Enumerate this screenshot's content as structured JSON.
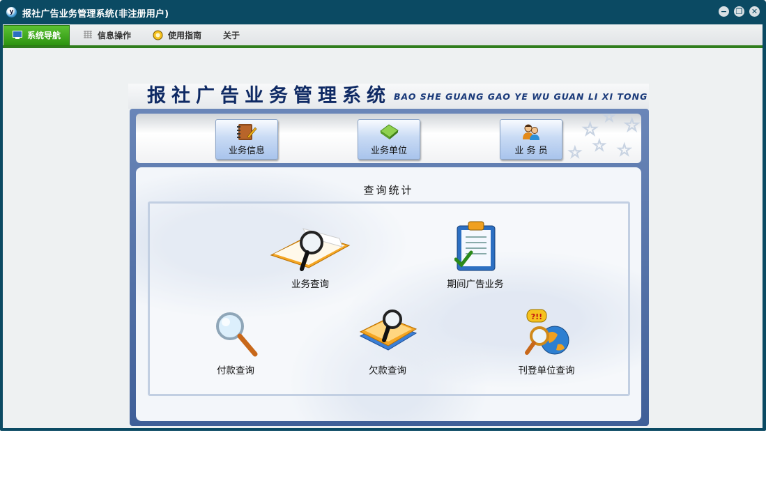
{
  "window": {
    "title": "报社广告业务管理系统(非注册用户)",
    "controls": [
      "minimize",
      "restore",
      "close"
    ]
  },
  "menu": {
    "items": [
      {
        "label": "系统导航",
        "icon": "monitor-icon",
        "active": true
      },
      {
        "label": "信息操作",
        "icon": "grid-icon",
        "active": false
      },
      {
        "label": "使用指南",
        "icon": "guide-icon",
        "active": false
      },
      {
        "label": "关于",
        "icon": "",
        "active": false
      }
    ]
  },
  "banner": {
    "title_cn": "报社广告业务管理系统",
    "title_en": "BAO SHE GUANG GAO YE WU GUAN LI XI TONG"
  },
  "nav": {
    "buttons": [
      {
        "label": "业务信息",
        "icon": "notebook-icon"
      },
      {
        "label": "业务单位",
        "icon": "diamond-icon"
      },
      {
        "label": "业 务 员",
        "icon": "users-icon"
      }
    ]
  },
  "query": {
    "title": "查询统计",
    "items": [
      {
        "label": "业务查询",
        "icon": "book-magnifier-icon"
      },
      {
        "label": "期间广告业务",
        "icon": "clipboard-check-icon"
      },
      {
        "label": "付款查询",
        "icon": "magnifier-icon"
      },
      {
        "label": "欠款查询",
        "icon": "books-magnifier-icon"
      },
      {
        "label": "刊登单位查询",
        "icon": "globe-magnifier-icon"
      }
    ]
  },
  "colors": {
    "titlebar": "#0b4a63",
    "menu_active": "#3aa51d",
    "frame": "#4f6fa8"
  }
}
